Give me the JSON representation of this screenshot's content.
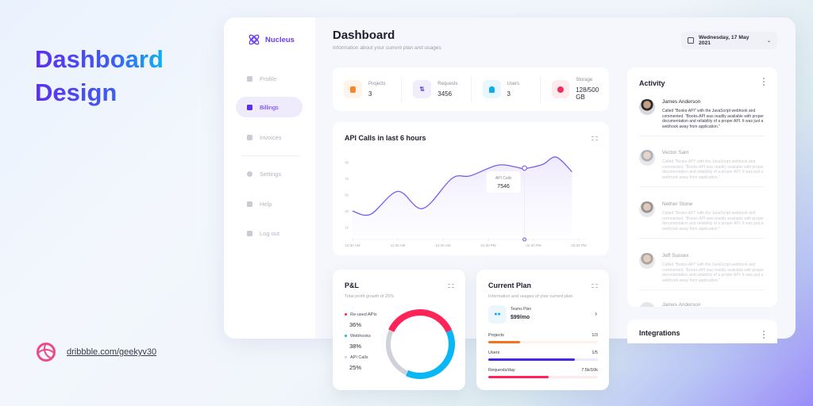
{
  "promo": {
    "title_line1": "Dashboard",
    "title_line2": "Design",
    "link": "dribbble.com/geekyv30"
  },
  "app": {
    "brand": "Nucleus",
    "sidebar": {
      "items": [
        {
          "label": "Profile",
          "icon": "user-icon",
          "active": false
        },
        {
          "label": "Billings",
          "icon": "billing-icon",
          "active": true
        },
        {
          "label": "Invoices",
          "icon": "invoice-icon",
          "active": false
        },
        {
          "label": "Settings",
          "icon": "gear-icon",
          "active": false
        },
        {
          "label": "Help",
          "icon": "phone-icon",
          "active": false
        },
        {
          "label": "Log out",
          "icon": "logout-icon",
          "active": false
        }
      ]
    },
    "header": {
      "title": "Dashboard",
      "subtitle": "Information about your current plan and usages",
      "date": "Wednesday, 17 May 2021"
    },
    "stats": [
      {
        "label": "Projects",
        "value": "3",
        "color": "#f5872a",
        "bg": "#fff4ea"
      },
      {
        "label": "Requests",
        "value": "3456",
        "color": "#5b2ef0",
        "bg": "#f0edfd"
      },
      {
        "label": "Users",
        "value": "3",
        "color": "#11a9f0",
        "bg": "#e8f6fd"
      },
      {
        "label": "Storage",
        "value": "128/500 GB",
        "color": "#ef2f5a",
        "bg": "#fdebef"
      }
    ],
    "pl": {
      "title": "P&L",
      "subtitle": "Total profit growth of 25%",
      "segments": [
        {
          "label": "Re-used APIs",
          "value": "36%",
          "pct": 36,
          "color": "#ff2457"
        },
        {
          "label": "Webhooks",
          "value": "38%",
          "pct": 38,
          "color": "#09b7f5"
        },
        {
          "label": "API Calls",
          "value": "25%",
          "pct": 25,
          "color": "#d0d2d9"
        }
      ]
    },
    "plan": {
      "title": "Current Plan",
      "subtitle": "Information and usages of your current plan",
      "plan_name": "Teams Plan",
      "plan_price": "$99/mo",
      "usages": [
        {
          "label": "Projects",
          "value": "1/3",
          "fraction": 0.29,
          "color": "#f5731d",
          "track": "#fdf1ea"
        },
        {
          "label": "Users",
          "value": "1/5",
          "fraction": 0.79,
          "color": "#4c25e6",
          "track": "#ecebfc"
        },
        {
          "label": "Requests/day",
          "value": "7.5k/10k",
          "fraction": 0.55,
          "color": "#ff2457",
          "track": "#fde9ee"
        }
      ]
    },
    "activity": {
      "title": "Activity",
      "items": [
        {
          "name": "James Anderson",
          "text": "Called \"Books-API\" with the JavaScript webhook and commented. \"Books-API was readily available with proper documentation and reliability of a proper API. It was just a webhook away from application.\"",
          "faded": false
        },
        {
          "name": "Vector Sam",
          "text": "Called \"Books-API\" with the JavaScript webhook and commented. \"Books-API was readily available with proper documentation and reliability of a proper API. It was just a webhook away from application.\"",
          "faded": true
        },
        {
          "name": "Nether Stone",
          "text": "Called \"Books-API\" with the JavaScript webhook and commented. \"Books-API was readily available with proper documentation and reliability of a proper API. It was just a webhook away from application.\"",
          "faded": true
        },
        {
          "name": "Jeff Sussex",
          "text": "Called \"Books-API\" with the JavaScript webhook and commented. \"Books-API was readily available with proper documentation and reliability of a proper API. It was just a webhook away from application.\"",
          "faded": true
        },
        {
          "name": "James Anderson",
          "text": "",
          "faded": true
        }
      ]
    },
    "integrations": {
      "title": "Integrations"
    }
  },
  "chart_data": {
    "type": "line",
    "title": "API Calls in last 6 hours",
    "x": [
      "10:30 AM",
      "11:30 AM",
      "12:30 AM",
      "01:30 PM",
      "02:30 PM",
      "03:30 PM"
    ],
    "y_ticks": [
      "1k",
      "3k",
      "5k",
      "7k",
      "9k"
    ],
    "ylim": [
      0,
      10000
    ],
    "series": [
      {
        "name": "API Calls",
        "color": "#7b5cf0",
        "points": [
          [
            0,
            3000
          ],
          [
            0.4,
            2600
          ],
          [
            1.0,
            5400
          ],
          [
            1.55,
            3300
          ],
          [
            2.2,
            7000
          ],
          [
            2.6,
            7300
          ],
          [
            3.2,
            8600
          ],
          [
            3.6,
            8400
          ],
          [
            3.8,
            8200
          ],
          [
            4.2,
            8700
          ],
          [
            4.5,
            9600
          ],
          [
            4.85,
            7800
          ]
        ]
      }
    ],
    "tooltip": {
      "label": "API Calls",
      "value": "7546",
      "x": 3.8
    },
    "grid": false
  }
}
